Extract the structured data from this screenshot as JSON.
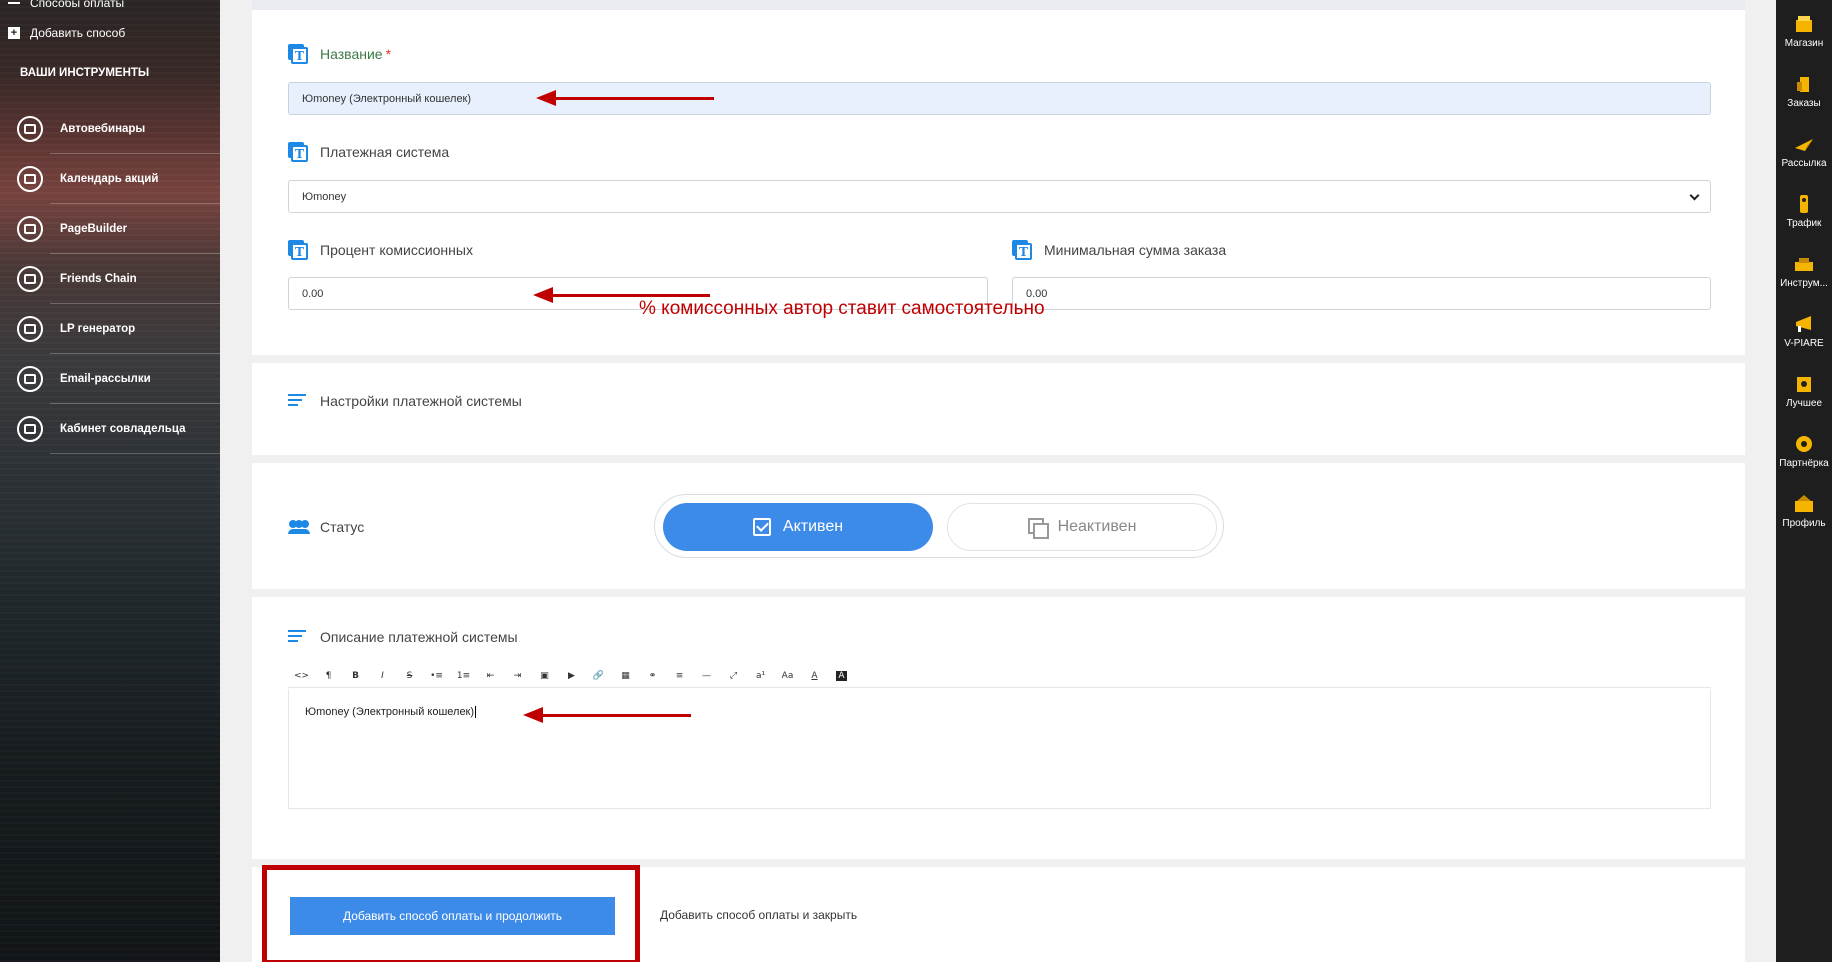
{
  "sidebar": {
    "top_items": [
      {
        "label": "Способы оплаты"
      },
      {
        "label": "Добавить способ"
      }
    ],
    "section_title": "ВАШИ ИНСТРУМЕНТЫ",
    "items": [
      {
        "label": "Автовебинары",
        "icon": "webinar-icon"
      },
      {
        "label": "Календарь акций",
        "icon": "calendar-icon"
      },
      {
        "label": "PageBuilder",
        "icon": "pagebuilder-icon"
      },
      {
        "label": "Friends Chain",
        "icon": "friends-icon"
      },
      {
        "label": "LP генератор",
        "icon": "lp-generator-icon"
      },
      {
        "label": "Email-рассылки",
        "icon": "email-icon"
      },
      {
        "label": "Кабинет совладельца",
        "icon": "handshake-icon"
      }
    ]
  },
  "right_toolbar": {
    "items": [
      {
        "label": "Магазин",
        "icon": "shop-icon",
        "color": "#f5b400"
      },
      {
        "label": "Заказы",
        "icon": "orders-icon",
        "color": "#f5b400"
      },
      {
        "label": "Рассылка",
        "icon": "mail-plane-icon",
        "color": "#f5b400"
      },
      {
        "label": "Трафик",
        "icon": "traffic-icon",
        "color": "#f5b400"
      },
      {
        "label": "Инструм...",
        "icon": "tools-icon",
        "color": "#f5b400"
      },
      {
        "label": "V-PIARE",
        "icon": "megaphone-icon",
        "color": "#f5b400"
      },
      {
        "label": "Лучшее",
        "icon": "best-icon",
        "color": "#f5b400"
      },
      {
        "label": "Партнёрка",
        "icon": "gear-partner-icon",
        "color": "#f5b400"
      },
      {
        "label": "Профиль",
        "icon": "profile-icon",
        "color": "#f5b400"
      }
    ]
  },
  "form": {
    "name_label": "Название",
    "name_required": "*",
    "name_value": "Юmoney (Электронный кошелек)",
    "payment_system_label": "Платежная система",
    "payment_system_value": "Юmoney",
    "commission_label": "Процент комиссионных",
    "commission_value": "0.00",
    "min_order_label": "Минимальная сумма заказа",
    "min_order_value": "0.00",
    "annotation": "% комиссонных автор ставит самостоятельно",
    "settings_title": "Настройки платежной системы",
    "status_label": "Статус",
    "status_active": "Активен",
    "status_inactive": "Неактивен",
    "description_title": "Описание платежной системы",
    "description_value": "Юmoney (Электронный кошелек)",
    "toolbar_buttons": [
      "<>",
      "¶",
      "B",
      "I",
      "S",
      "•≡",
      "1≡",
      "⇤",
      "⇥",
      "▣",
      "▶",
      "🔗",
      "▦",
      "⚭",
      "≡",
      "—",
      "⤢",
      "a¹",
      "Aa",
      "A",
      "A"
    ],
    "submit_continue": "Добавить способ оплаты и продолжить",
    "submit_close": "Добавить способ оплаты и закрыть"
  },
  "colors": {
    "accent": "#3d8be8",
    "annotation": "#c00000"
  }
}
